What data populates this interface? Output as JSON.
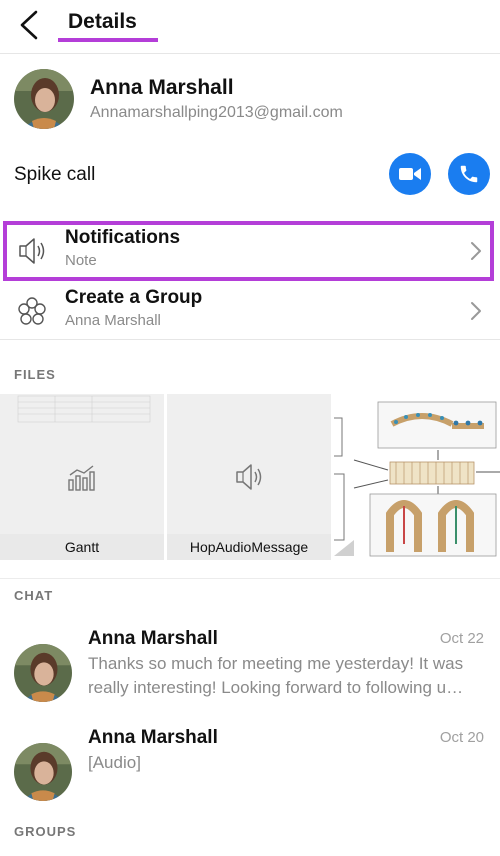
{
  "header": {
    "title": "Details"
  },
  "profile": {
    "name": "Anna Marshall",
    "email": "Annamarshallping2013@gmail.com"
  },
  "spike": {
    "label": "Spike call"
  },
  "rows": [
    {
      "title": "Notifications",
      "subtitle": "Note",
      "icon": "speaker-icon"
    },
    {
      "title": "Create a Group",
      "subtitle": "Anna Marshall",
      "icon": "group-icon"
    }
  ],
  "sections": {
    "files": "FILES",
    "chat": "CHAT",
    "groups": "GROUPS"
  },
  "files": [
    {
      "label": "Gantt",
      "icon": "chart-icon"
    },
    {
      "label": "HopAudioMessage",
      "icon": "speaker-icon"
    }
  ],
  "chats": [
    {
      "name": "Anna Marshall",
      "date": "Oct 22",
      "message": "Thanks so much for meeting me yesterday! It was really interesting! Looking forward to following u…"
    },
    {
      "name": "Anna Marshall",
      "date": "Oct 20",
      "message": "[Audio]"
    }
  ],
  "colors": {
    "accent": "#1a7df0",
    "highlight": "#b43ed8"
  }
}
